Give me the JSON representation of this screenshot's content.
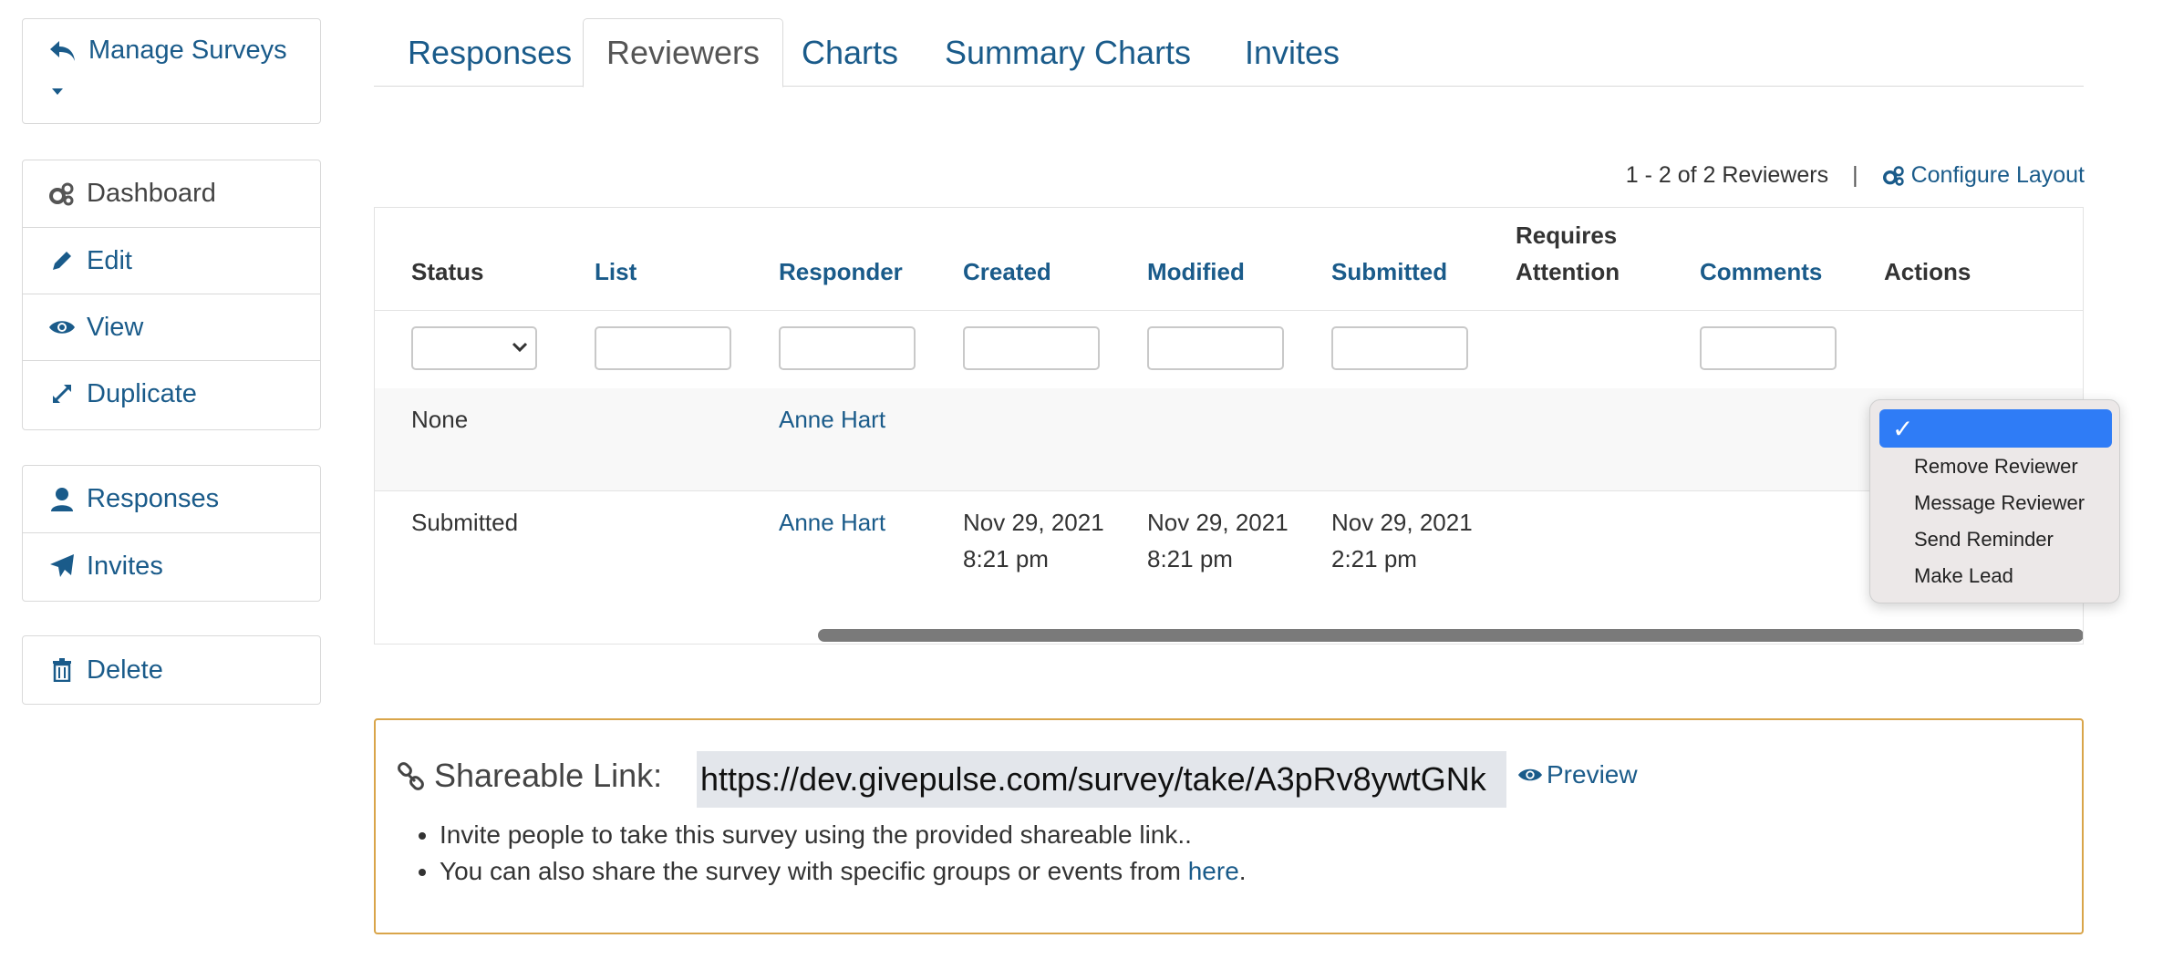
{
  "sidebar": {
    "manage_label": "Manage Surveys",
    "group1": [
      {
        "label": "Dashboard",
        "icon": "gears-icon"
      },
      {
        "label": "Edit",
        "icon": "pencil-icon"
      },
      {
        "label": "View",
        "icon": "eye-icon"
      },
      {
        "label": "Duplicate",
        "icon": "expand-icon"
      }
    ],
    "group2": [
      {
        "label": "Responses",
        "icon": "user-icon"
      },
      {
        "label": "Invites",
        "icon": "paper-plane-icon"
      }
    ],
    "delete_label": "Delete"
  },
  "tabs": [
    "Responses",
    "Reviewers",
    "Charts",
    "Summary Charts",
    "Invites"
  ],
  "active_tab": "Reviewers",
  "meta": {
    "count_text": "1 - 2 of 2 Reviewers",
    "separator": "|",
    "configure_label": "Configure Layout"
  },
  "table": {
    "headers": {
      "status": "Status",
      "list": "List",
      "responder": "Responder",
      "created": "Created",
      "modified": "Modified",
      "submitted": "Submitted",
      "requires_1": "Requires",
      "requires_2": "Attention",
      "comments": "Comments",
      "actions": "Actions"
    },
    "rows": [
      {
        "status": "None",
        "responder": "Anne Hart",
        "created_1": "",
        "created_2": "",
        "modified_1": "",
        "modified_2": "",
        "submitted_1": "",
        "submitted_2": ""
      },
      {
        "status": "Submitted",
        "responder": "Anne Hart",
        "created_1": "Nov 29, 2021",
        "created_2": "8:21 pm",
        "modified_1": "Nov 29, 2021",
        "modified_2": "8:21 pm",
        "submitted_1": "Nov 29, 2021",
        "submitted_2": "2:21 pm"
      }
    ]
  },
  "actions_menu": {
    "selected": "✓",
    "items": [
      "Remove Reviewer",
      "Message Reviewer",
      "Send Reminder",
      "Make Lead"
    ]
  },
  "share": {
    "label": "Shareable Link:",
    "url": "https://dev.givepulse.com/survey/take/A3pRv8ywtGNk",
    "preview_label": "Preview",
    "bullet1": "Invite people to take this survey using the provided shareable link..",
    "bullet2_text": "You can also share the survey with specific groups or events from ",
    "bullet2_link": "here",
    "bullet2_end": "."
  },
  "colors": {
    "link": "#1a5b8a",
    "accent_border": "#d9a54a",
    "menu_selected": "#2f7cf6"
  }
}
